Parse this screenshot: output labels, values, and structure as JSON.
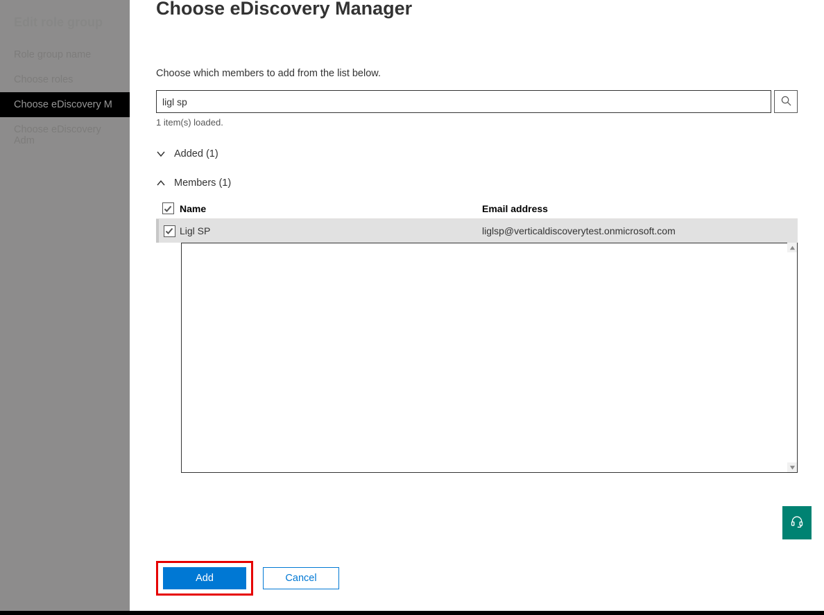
{
  "sidebar": {
    "header": "Edit role group",
    "items": [
      {
        "label": "Role group name",
        "active": false
      },
      {
        "label": "Choose roles",
        "active": false
      },
      {
        "label": "Choose eDiscovery M",
        "active": true
      },
      {
        "label": "Choose eDiscovery Adm",
        "active": false
      }
    ]
  },
  "panel": {
    "title": "Choose eDiscovery Manager",
    "subtitle": "Choose which members to add from the list below.",
    "search_value": "ligl sp",
    "loaded_text": "1 item(s) loaded.",
    "added_label": "Added (1)",
    "members_label": "Members (1)",
    "columns": {
      "name": "Name",
      "email": "Email address"
    },
    "rows": [
      {
        "name": "Ligl SP",
        "email": "liglsp@verticaldiscoverytest.onmicrosoft.com",
        "checked": true
      }
    ]
  },
  "footer": {
    "add": "Add",
    "cancel": "Cancel"
  },
  "icons": {
    "search": "search-icon",
    "chev_down": "chevron-down-icon",
    "chev_up": "chevron-up-icon",
    "help": "headset-icon"
  }
}
